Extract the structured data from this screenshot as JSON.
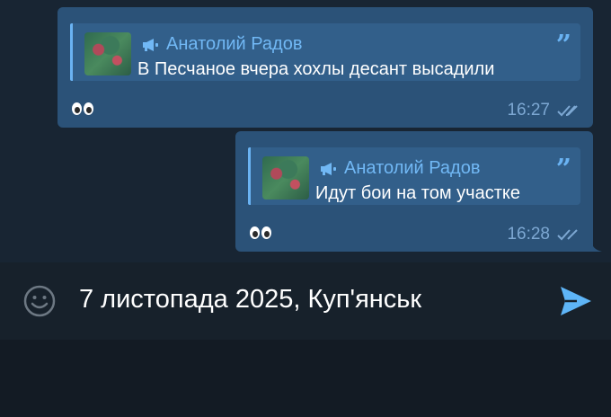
{
  "messages": [
    {
      "quote": {
        "author": "Анатолий Радов",
        "text": "В Песчаное вчера хохлы десант высадили",
        "icon": "megaphone-icon"
      },
      "reaction": "eyes",
      "time": "16:27",
      "status": "read"
    },
    {
      "quote": {
        "author": "Анатолий Радов",
        "text": "Идут бои на том участке",
        "icon": "megaphone-icon"
      },
      "reaction": "eyes",
      "time": "16:28",
      "status": "read"
    }
  ],
  "composer": {
    "text": "7 листопада 2025, Куп'янськ",
    "emoji_icon": "smile-icon",
    "send_icon": "send-icon"
  },
  "colors": {
    "bubble": "#2b5278",
    "accent": "#6ab3f3",
    "background": "#182533"
  }
}
